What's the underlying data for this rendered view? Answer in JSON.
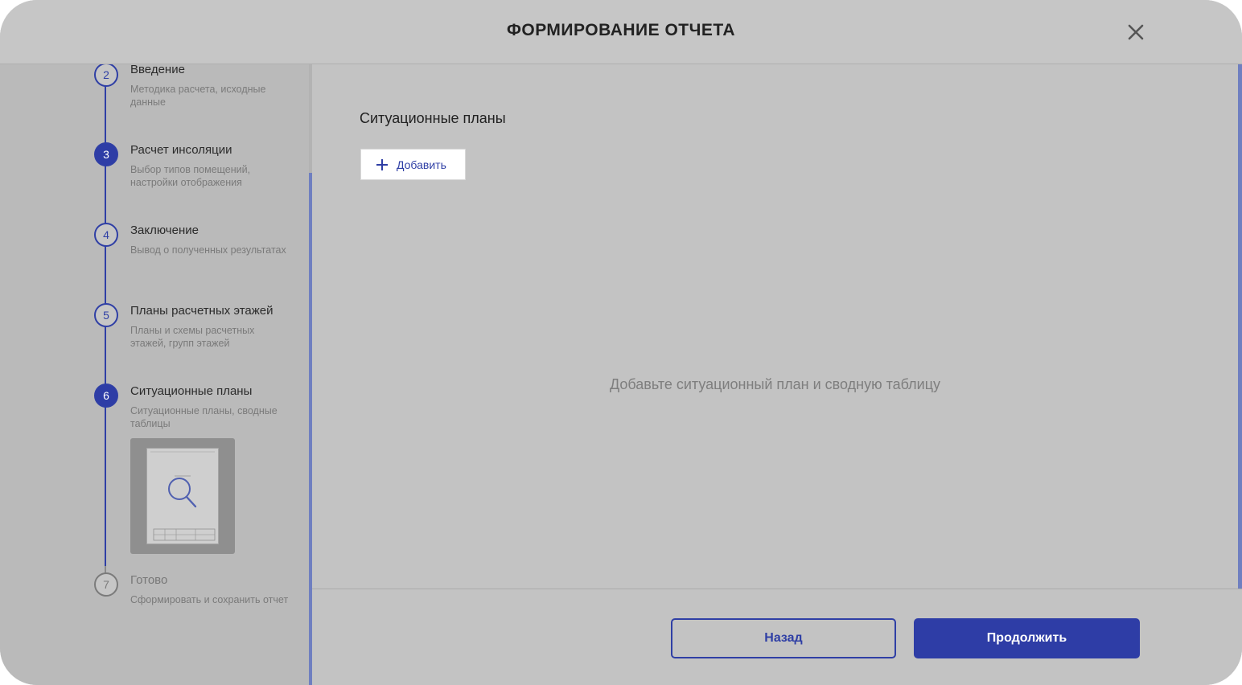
{
  "header": {
    "title": "ФОРМИРОВАНИЕ ОТЧЕТА",
    "close_icon": "close-icon"
  },
  "sidebar": {
    "steps": [
      {
        "number": "2",
        "title": "Введение",
        "desc": "Методика расчета, исходные данные",
        "state": "done"
      },
      {
        "number": "3",
        "title": "Расчет инсоляции",
        "desc": "Выбор типов помещений, настройки отображения",
        "state": "active"
      },
      {
        "number": "4",
        "title": "Заключение",
        "desc": "Вывод о полученных результатах",
        "state": "done"
      },
      {
        "number": "5",
        "title": "Планы расчетных этажей",
        "desc": "Планы и схемы расчетных этажей, групп этажей",
        "state": "done"
      },
      {
        "number": "6",
        "title": "Ситуационные планы",
        "desc": "Ситуационные планы, сводные таблицы",
        "state": "active"
      },
      {
        "number": "7",
        "title": "Готово",
        "desc": "Сформировать и сохранить отчет",
        "state": "pending"
      }
    ],
    "thumbnail_icon": "magnifier-icon"
  },
  "main": {
    "section_title": "Ситуационные планы",
    "add_label": "Добавить",
    "empty_message": "Добавьте ситуационный план и сводную таблицу"
  },
  "footer": {
    "back_label": "Назад",
    "continue_label": "Продолжить"
  },
  "colors": {
    "accent": "#2e3da6",
    "overlay": "#c3c3c3"
  }
}
